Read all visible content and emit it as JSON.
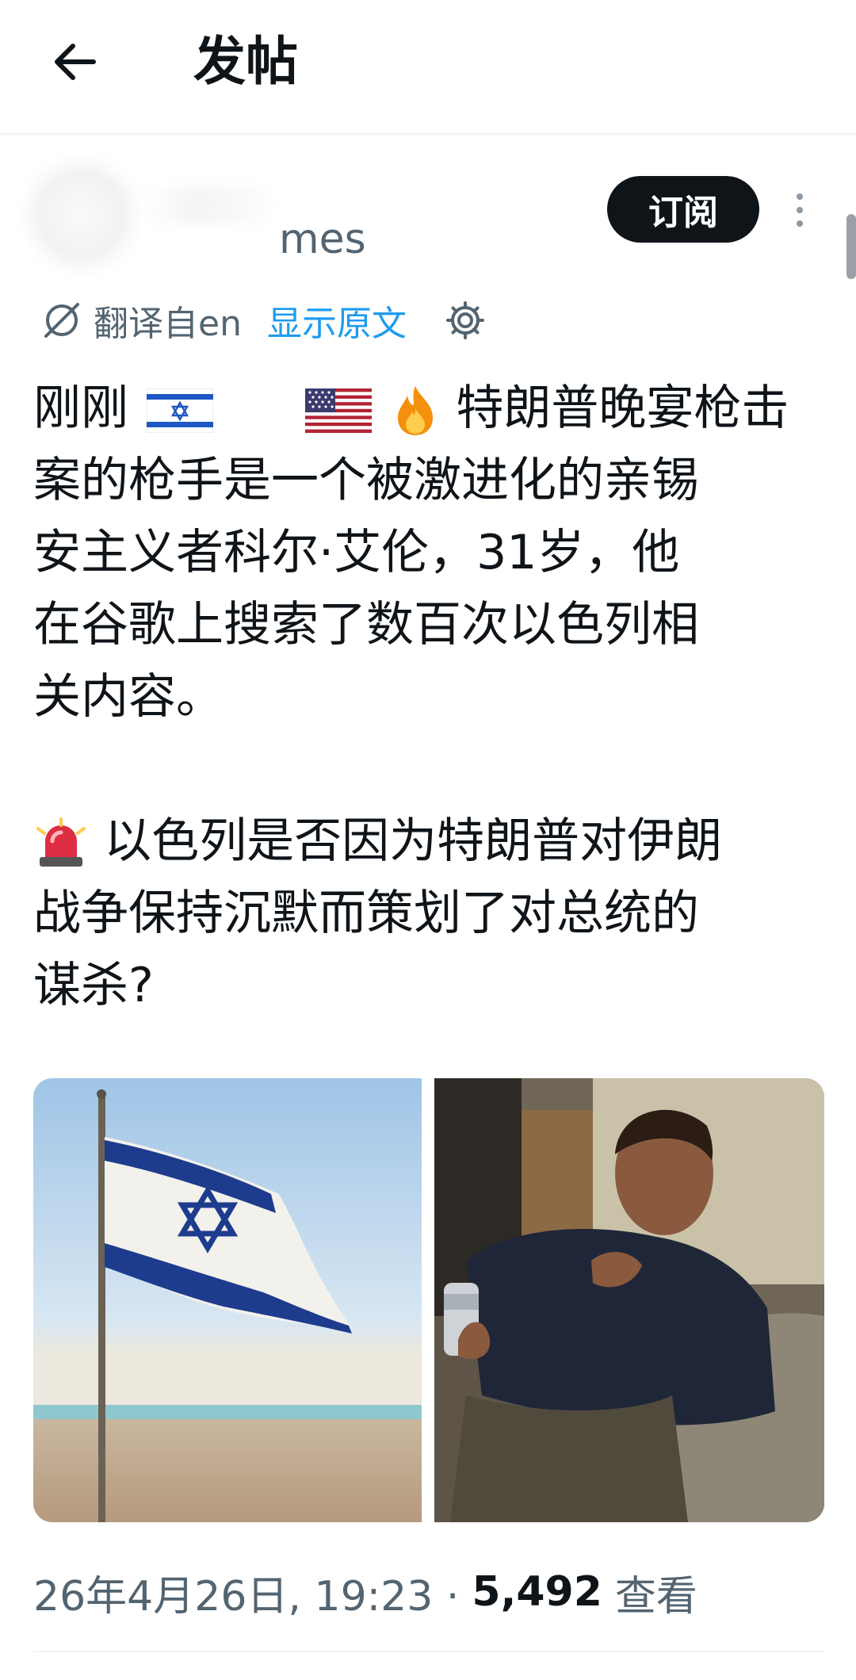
{
  "header": {
    "title": "发帖"
  },
  "author": {
    "handle_fragment": "mes"
  },
  "actions": {
    "subscribe_label": "订阅"
  },
  "translation": {
    "label": "翻译自en",
    "show_original": "显示原文"
  },
  "post": {
    "line1_a": "刚刚",
    "line1_b": "特朗普晚宴枪击",
    "line2": "案的枪手是一个被激进化的亲锡",
    "line3": "安主义者科尔·艾伦，31岁，他",
    "line4": "在谷歌上搜索了数百次以色列相",
    "line5": "关内容。",
    "line6": "以色列是否因为特朗普对伊朗",
    "line7": "战争保持沉默而策划了对总统的",
    "line8": "谋杀?"
  },
  "meta": {
    "timestamp": "26年4月26日, 19:23 ·",
    "views": "5,492",
    "views_label": "查看"
  },
  "icons": {
    "back": "arrow-left-icon",
    "more": "more-vertical-icon",
    "translate": "translate-icon",
    "settings": "gear-icon",
    "israel_flag": "israel-flag-emoji",
    "us_flag": "us-flag-emoji",
    "fire": "fire-emoji",
    "siren": "siren-emoji"
  },
  "colors": {
    "accent": "#1d9bf0",
    "text": "#0f1419",
    "secondary": "#536471",
    "button": "#0f1419"
  }
}
